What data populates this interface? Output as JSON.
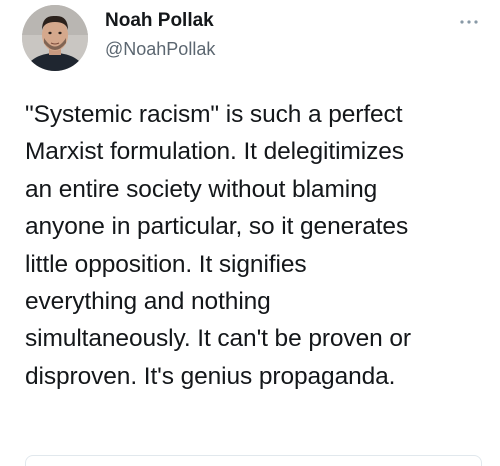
{
  "author": {
    "name": "Noah Pollak",
    "handle": "@NoahPollak"
  },
  "tweet": {
    "lines": [
      "\"Systemic racism\" is such a perfect",
      "Marxist formulation. It delegitimizes",
      "an entire society without blaming",
      "anyone in particular, so it generates",
      "little opposition. It signifies",
      "everything and nothing",
      "simultaneously. It can't be proven or",
      "disproven. It's genius propaganda."
    ]
  },
  "icons": {
    "more": "more-dots-icon",
    "avatar": "profile-photo"
  },
  "colors": {
    "text": "#14171a",
    "secondary_text": "#5b6670",
    "background": "#ffffff",
    "divider": "#e1e8ed"
  }
}
